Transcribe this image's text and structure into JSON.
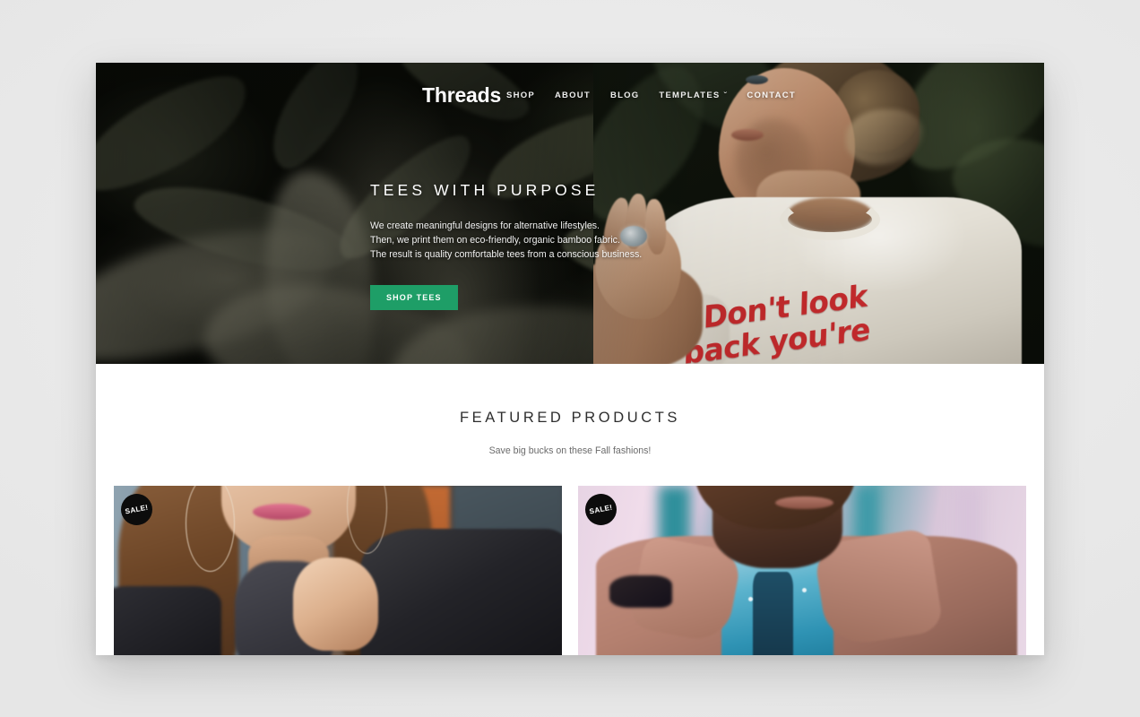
{
  "site": {
    "brand": "Threads",
    "nav": [
      {
        "label": "SHOP",
        "has_caret": false
      },
      {
        "label": "ABOUT",
        "has_caret": false
      },
      {
        "label": "BLOG",
        "has_caret": false
      },
      {
        "label": "TEMPLATES",
        "has_caret": true
      },
      {
        "label": "CONTACT",
        "has_caret": false
      }
    ],
    "caret_glyph": "ˇ"
  },
  "hero": {
    "title": "TEES WITH PURPOSE",
    "paragraph": "We create meaningful designs for alternative lifestyles.\nThen, we print them on eco-friendly, organic bamboo fabric.\nThe result is quality comfortable tees from a conscious business.",
    "cta_label": "SHOP TEES",
    "cta_color": "#1e9e67",
    "image_alt": "Woman in white graphic tee standing in front of dark green foliage",
    "tee_graphic_text": "“Don't look\nback you're"
  },
  "featured": {
    "title": "FEATURED PRODUCTS",
    "subtitle": "Save big bucks on these Fall fashions!",
    "products": [
      {
        "badge": "SALE!",
        "image_alt": "Woman with long brown hair, hoop earrings, black leather jacket and grey knit scarf"
      },
      {
        "badge": "SALE!",
        "image_alt": "Man in tan leather jacket with blue patterned shirt and navy tie"
      }
    ]
  },
  "theme": {
    "page_background": "#ececec",
    "surface": "#ffffff",
    "accent": "#1e9e67",
    "badge_background": "#0c0c0c",
    "heading_color": "#2e2e2e",
    "muted_text": "#6b6b6b"
  }
}
